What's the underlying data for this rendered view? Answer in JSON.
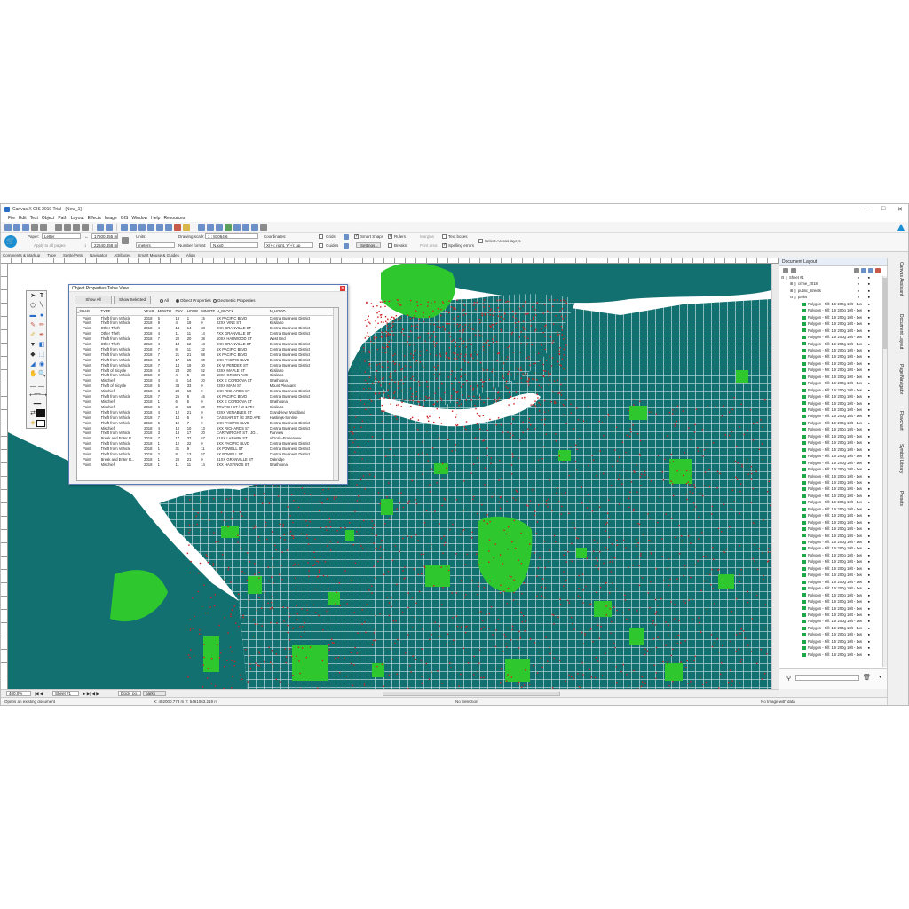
{
  "window": {
    "title": "Canvas X GIS 2019 Trial - [New_1]",
    "controls": [
      "–",
      "□",
      "✕"
    ]
  },
  "menu": [
    "File",
    "Edit",
    "Text",
    "Object",
    "Path",
    "Layout",
    "Effects",
    "Image",
    "GIS",
    "Window",
    "Help",
    "Resources"
  ],
  "propbar": {
    "paper_label": "Paper:",
    "paper_value": "Letter",
    "apply_all_pages": "Apply to all pages",
    "w_value": "17500.855 m",
    "h_value": "22640.458 m",
    "units_label": "Units:",
    "units_value": "meters",
    "drawing_scale_label": "Drawing scale:",
    "drawing_scale_value": "1 : 81064.6",
    "number_format_label": "Number format:",
    "number_format_value": "N.xx0",
    "coordinates_label": "Coordinates:",
    "coord_value_1": "",
    "coord_value_2": "X(+): right, Y(+): up",
    "grids": "Grids",
    "guides": "Guides",
    "smart_snaps": "Smart Snaps",
    "settings": "Settings...",
    "rulers": "Rulers",
    "breaks": "Breaks",
    "margins": "Margins",
    "print_area": "Print area",
    "text_boxes": "Text boxes",
    "spelling_errors": "Spelling errors",
    "select_across_layers": "Select Across layers"
  },
  "tabs": [
    "Comments & Markup",
    "Type",
    "Sprite/Pets",
    "Navigator",
    "Attributes",
    "Smart Mouse & Guides",
    "Align"
  ],
  "dialog": {
    "title": "Object Properties Table View",
    "show_all": "Show All",
    "show_selected": "Show Selected",
    "radio_all": "All",
    "radio_object": "Object Properties",
    "radio_geometric": "Geometric Properties",
    "columns": [
      "_SHAP...",
      "TYPE",
      "YEAR",
      "MONTH",
      "DAY",
      "HOUR",
      "MINUTE",
      "H_BLOCK",
      "N_HOOD"
    ],
    "rows": [
      [
        "Point",
        "Theft from Vehicle",
        "2018",
        "5",
        "19",
        "1",
        "15",
        "5X PACIFIC BLVD",
        "Central Business District"
      ],
      [
        "Point",
        "Theft from Vehicle",
        "2018",
        "9",
        "4",
        "19",
        "0",
        "22XX VINE ST",
        "Kitsilano"
      ],
      [
        "Point",
        "Other Theft",
        "2018",
        "4",
        "14",
        "14",
        "33",
        "9XX GRANVILLE ST",
        "Central Business District"
      ],
      [
        "Point",
        "Other Theft",
        "2018",
        "4",
        "11",
        "11",
        "14",
        "7XX GRANVILLE ST",
        "Central Business District"
      ],
      [
        "Point",
        "Theft from Vehicle",
        "2018",
        "7",
        "20",
        "20",
        "38",
        "10XX HARWOOD ST",
        "West End"
      ],
      [
        "Point",
        "Other Theft",
        "2018",
        "4",
        "13",
        "12",
        "48",
        "9XX GRANVILLE ST",
        "Central Business District"
      ],
      [
        "Point",
        "Theft from Vehicle",
        "2018",
        "7",
        "8",
        "11",
        "32",
        "5X PACIFIC BLVD",
        "Central Business District"
      ],
      [
        "Point",
        "Theft from Vehicle",
        "2018",
        "7",
        "21",
        "21",
        "58",
        "5X PACIFIC BLVD",
        "Central Business District"
      ],
      [
        "Point",
        "Theft from Vehicle",
        "2018",
        "8",
        "17",
        "15",
        "30",
        "6XX PACIFIC BLVD",
        "Central Business District"
      ],
      [
        "Point",
        "Theft from Vehicle",
        "2018",
        "7",
        "14",
        "19",
        "30",
        "8X W PENDER ST",
        "Central Business District"
      ],
      [
        "Point",
        "Theft of Bicycle",
        "2018",
        "4",
        "23",
        "20",
        "52",
        "23XX MAPLE ST",
        "Kitsilano"
      ],
      [
        "Point",
        "Theft from Vehicle",
        "2018",
        "9",
        "4",
        "5",
        "23",
        "18XX GREEN AVE",
        "Kitsilano"
      ],
      [
        "Point",
        "Mischief",
        "2018",
        "4",
        "4",
        "14",
        "20",
        "3XX E CORDOVA ST",
        "Strathcona"
      ],
      [
        "Point",
        "Theft of Bicycle",
        "2018",
        "5",
        "33",
        "33",
        "0",
        "23XX MAIN ST",
        "Mount Pleasant"
      ],
      [
        "Point",
        "Mischief",
        "2018",
        "8",
        "24",
        "18",
        "0",
        "6XX RICHARDS ST",
        "Central Business District"
      ],
      [
        "Point",
        "Theft from Vehicle",
        "2018",
        "7",
        "25",
        "6",
        "45",
        "5X PACIFIC BLVD",
        "Central Business District"
      ],
      [
        "Point",
        "Mischief",
        "2018",
        "1",
        "6",
        "5",
        "0",
        "3XX E CORDOVA ST",
        "Strathcona"
      ],
      [
        "Point",
        "Mischief",
        "2018",
        "6",
        "3",
        "18",
        "30",
        "TRUTCH ST / W 14TH",
        "Kitsilano"
      ],
      [
        "Point",
        "Theft from Vehicle",
        "2018",
        "4",
        "12",
        "21",
        "0",
        "23XX VENABLES ST",
        "Grandview Woodland"
      ],
      [
        "Point",
        "Theft from Vehicle",
        "2018",
        "7",
        "14",
        "5",
        "0",
        "CASSIAR ST / E 3RD AVE",
        "Hastings-Sunrise"
      ],
      [
        "Point",
        "Theft from Vehicle",
        "2018",
        "5",
        "19",
        "7",
        "0",
        "6XX PACIFIC BLVD",
        "Central Business District"
      ],
      [
        "Point",
        "Mischief",
        "2018",
        "4",
        "10",
        "10",
        "13",
        "5XX RICHARDS ST",
        "Central Business District"
      ],
      [
        "Point",
        "Theft from Vehicle",
        "2018",
        "3",
        "13",
        "17",
        "20",
        "CARTWRIGHT ST / JO...",
        "Fairview"
      ],
      [
        "Point",
        "Break and Enter R...",
        "2018",
        "7",
        "17",
        "37",
        "67",
        "61XX LANARK ST",
        "Victoria-Fraserview"
      ],
      [
        "Point",
        "Theft from Vehicle",
        "2018",
        "1",
        "12",
        "22",
        "0",
        "6XX PACIFIC BLVD",
        "Central Business District"
      ],
      [
        "Point",
        "Theft from Vehicle",
        "2018",
        "1",
        "31",
        "9",
        "11",
        "5X POWELL ST",
        "Central Business District"
      ],
      [
        "Point",
        "Theft from Vehicle",
        "2018",
        "2",
        "8",
        "13",
        "57",
        "5X POWELL ST",
        "Central Business District"
      ],
      [
        "Point",
        "Break and Enter R...",
        "2018",
        "1",
        "26",
        "21",
        "0",
        "61XX GRANVILLE ST",
        "Oakridge"
      ],
      [
        "Point",
        "Mischief",
        "2018",
        "1",
        "11",
        "11",
        "14",
        "8XX HASTINGS ST",
        "Strathcona"
      ]
    ]
  },
  "layers_panel": {
    "title": "Document Layout",
    "sheet": "Sheet #1",
    "layers": [
      "crime_2018",
      "public_streets",
      "parks"
    ],
    "polygon_label": "Polygon - Fill: 1ltr 200g 10lt - 1 w",
    "polygon_count": 54
  },
  "side_tabs": [
    "Canvas Assistant",
    "Document Layout",
    "Page Navigator",
    "Flowchart",
    "Symbol Library",
    "Presets"
  ],
  "status": {
    "zoom": "400.0%",
    "sheet": "Sheet #1",
    "layer_tab_1": "block_po...",
    "layer_tab_2": "parks",
    "message": "Opens an existing document",
    "coords": "X: 482000.773 m  Y: 5461063.219 m",
    "selection": "No Selection",
    "image_data": "No Image with data"
  },
  "colors": {
    "land": "#127070",
    "park": "#2ec82e",
    "street": "#b8d8d8",
    "crime": "#cc2222",
    "water": "#ffffff"
  }
}
